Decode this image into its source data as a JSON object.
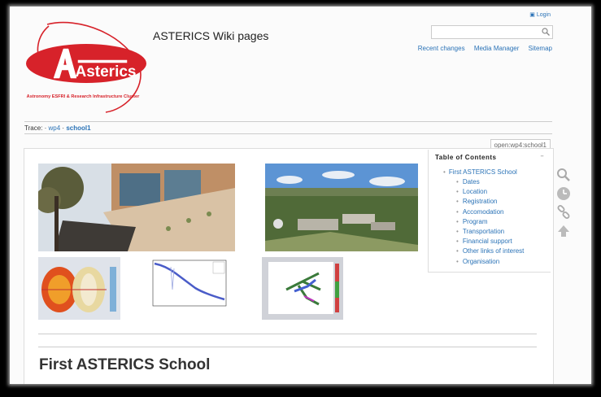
{
  "header": {
    "login_label": "Login",
    "site_title": "ASTERICS Wiki pages",
    "search_placeholder": "",
    "links": [
      "Recent changes",
      "Media Manager",
      "Sitemap"
    ]
  },
  "logo": {
    "word": "Asterics",
    "tagline": "Astronomy ESFRI & Research Infrastructure Cluster",
    "color": "#d7222a"
  },
  "breadcrumb": {
    "label": "Trace:",
    "items": [
      "wp4",
      "school1"
    ]
  },
  "page_id": "open:wp4:school1",
  "toc": {
    "title": "Table of Contents",
    "top": "First ASTERICS School",
    "items": [
      "Dates",
      "Location",
      "Registration",
      "Accomodation",
      "Program",
      "Transportation",
      "Financial support",
      "Other links of interest",
      "Organisation"
    ]
  },
  "main": {
    "heading": "First ASTERICS School"
  },
  "colors": {
    "link": "#2b73b7",
    "text": "#333333"
  },
  "icons": [
    "search-icon",
    "recent-icon",
    "backlinks-icon",
    "back-to-top-icon"
  ]
}
